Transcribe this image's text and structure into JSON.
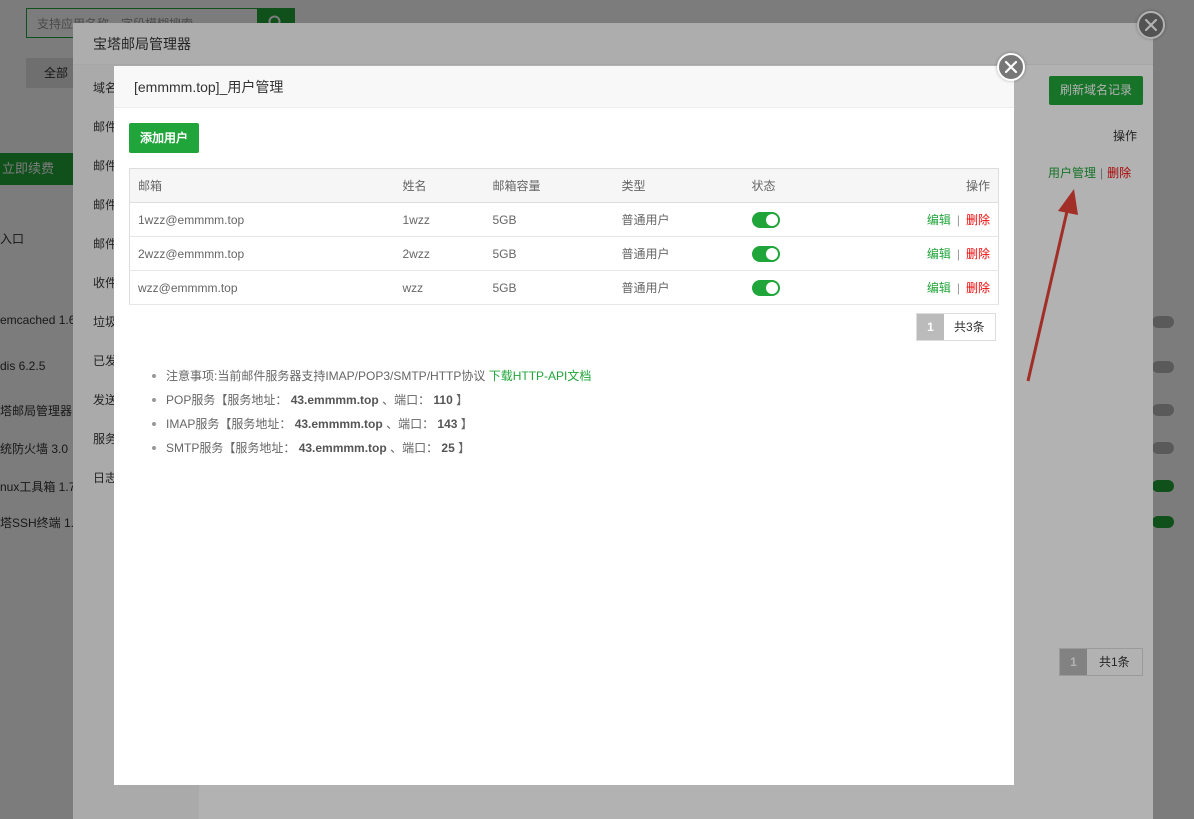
{
  "background": {
    "search_placeholder": "支持应用名称、字段模糊搜索",
    "top_tab": "全部",
    "renew_button": "立即续费",
    "entry_label": "入口",
    "list_items": [
      "emcached 1.6",
      "dis 6.2.5",
      "塔邮局管理器",
      "统防火墙 3.0",
      "nux工具箱 1.7",
      "塔SSH终端 1.0"
    ]
  },
  "mail_manager": {
    "title": "宝塔邮局管理器",
    "sidebar": [
      "域名",
      "邮件",
      "邮件",
      "邮件",
      "邮件",
      "收件",
      "垃圾",
      "已发",
      "发送",
      "服务",
      "日志"
    ],
    "refresh_button": "刷新域名记录",
    "ops_header": "操作",
    "ops": {
      "user_mgmt": "用户管理",
      "sep": "|",
      "delete": "删除"
    },
    "pager": {
      "current": "1",
      "total": "共1条"
    }
  },
  "user_dialog": {
    "title": "[emmmm.top]_用户管理",
    "add_button": "添加用户",
    "columns": {
      "email": "邮箱",
      "name": "姓名",
      "quota": "邮箱容量",
      "type": "类型",
      "status": "状态",
      "ops": "操作"
    },
    "rows": [
      {
        "email": "1wzz@emmmm.top",
        "name": "1wzz",
        "quota": "5GB",
        "type": "普通用户",
        "enabled": true
      },
      {
        "email": "2wzz@emmmm.top",
        "name": "2wzz",
        "quota": "5GB",
        "type": "普通用户",
        "enabled": true
      },
      {
        "email": "wzz@emmmm.top",
        "name": "wzz",
        "quota": "5GB",
        "type": "普通用户",
        "enabled": true
      }
    ],
    "row_ops": {
      "edit": "编辑",
      "sep": "|",
      "delete": "删除"
    },
    "pager": {
      "current": "1",
      "total": "共3条"
    },
    "notes": {
      "n1_text": "注意事项:当前邮件服务器支持IMAP/POP3/SMTP/HTTP协议",
      "n1_link": "下载HTTP-API文档",
      "pop_prefix": "POP服务【服务地址：",
      "pop_host": "43.emmmm.top",
      "pop_mid": "、端口：",
      "pop_port": "110",
      "imap_prefix": "IMAP服务【服务地址：",
      "imap_host": "43.emmmm.top",
      "imap_mid": "、端口：",
      "imap_port": "143",
      "smtp_prefix": "SMTP服务【服务地址：",
      "smtp_host": "43.emmmm.top",
      "smtp_mid": "、端口：",
      "smtp_port": "25",
      "close_bracket": "】"
    }
  },
  "colors": {
    "accent": "#20a53a",
    "danger": "#ef0808",
    "annotation_arrow": "#e8433a"
  }
}
